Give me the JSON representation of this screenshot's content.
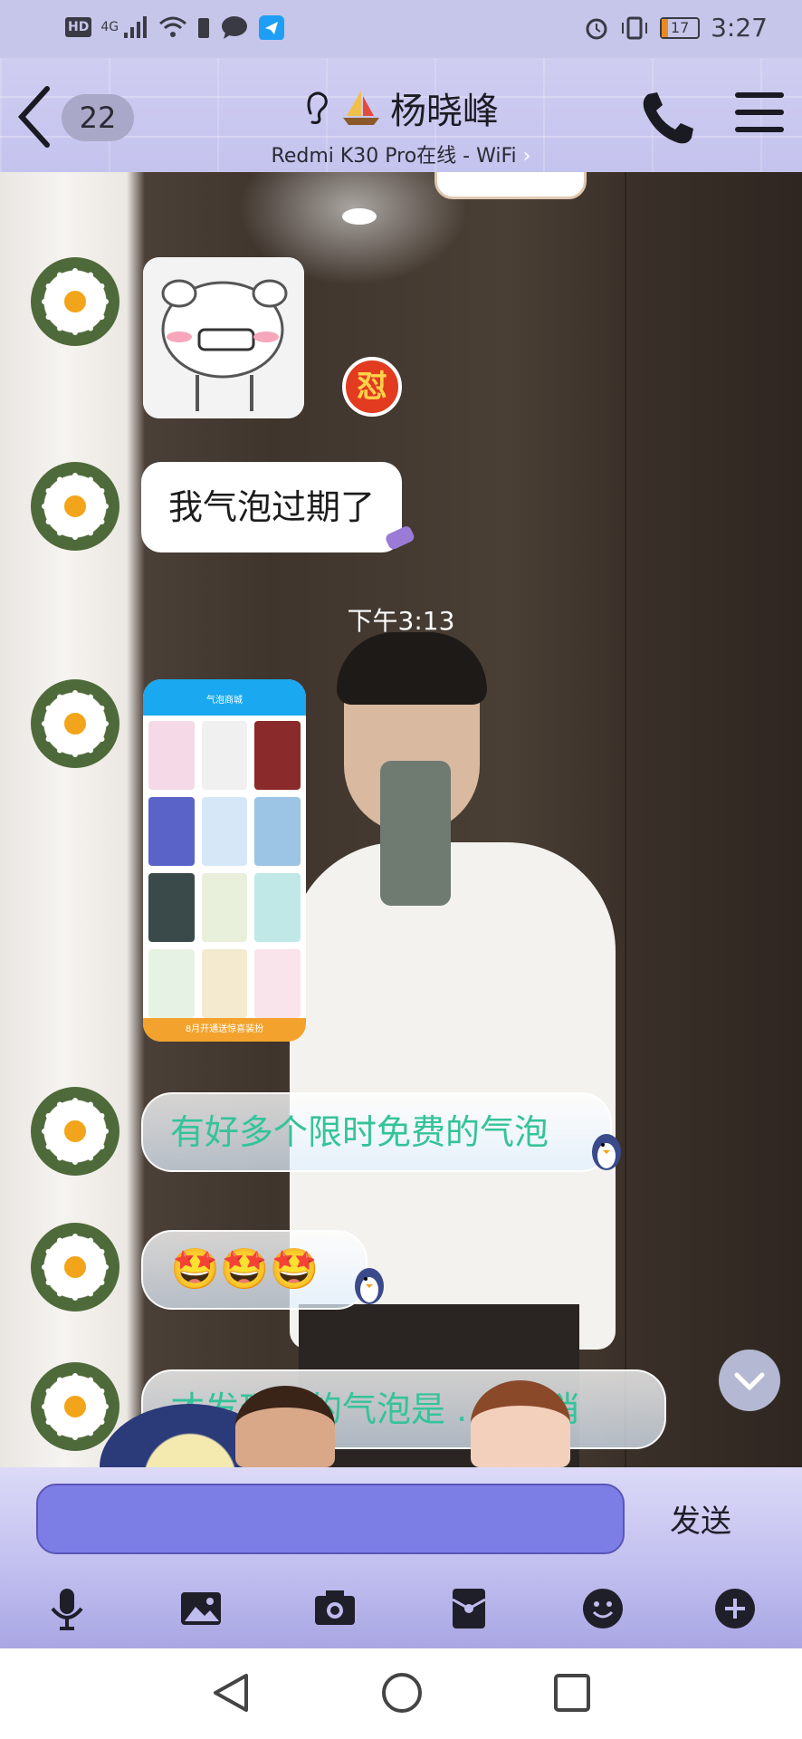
{
  "status_bar": {
    "network": "4G",
    "battery": "17",
    "time": "3:27"
  },
  "header": {
    "unread_count": "22",
    "contact_name": "杨晓峰",
    "device_status": "Redmi K30 Pro在线 - WiFi",
    "device_chevron": "›"
  },
  "chat": {
    "sticker_badge": "怼",
    "messages": [
      {
        "type": "sticker"
      },
      {
        "type": "text",
        "text": "我气泡过期了"
      },
      {
        "type": "time",
        "text": "下午3:13"
      },
      {
        "type": "image",
        "screenshot_title": "气泡商城",
        "screenshot_banner": "8月开通送惊喜装扮"
      },
      {
        "type": "text",
        "text": "有好多个限时免费的气泡"
      },
      {
        "type": "text",
        "text": "🤩🤩🤩"
      },
      {
        "type": "text",
        "text": "才发现你的气泡是 ...缘..消"
      }
    ]
  },
  "composer": {
    "input_value": "",
    "send_label": "发送"
  },
  "toolbar": {
    "items": [
      "microphone-icon",
      "image-icon",
      "camera-icon",
      "red-packet-icon",
      "emoji-icon",
      "plus-icon"
    ]
  },
  "colors": {
    "header_bg": "#c6c6ea",
    "input_bg": "#7d7de6",
    "bubble_text_green": "#34c39a"
  }
}
